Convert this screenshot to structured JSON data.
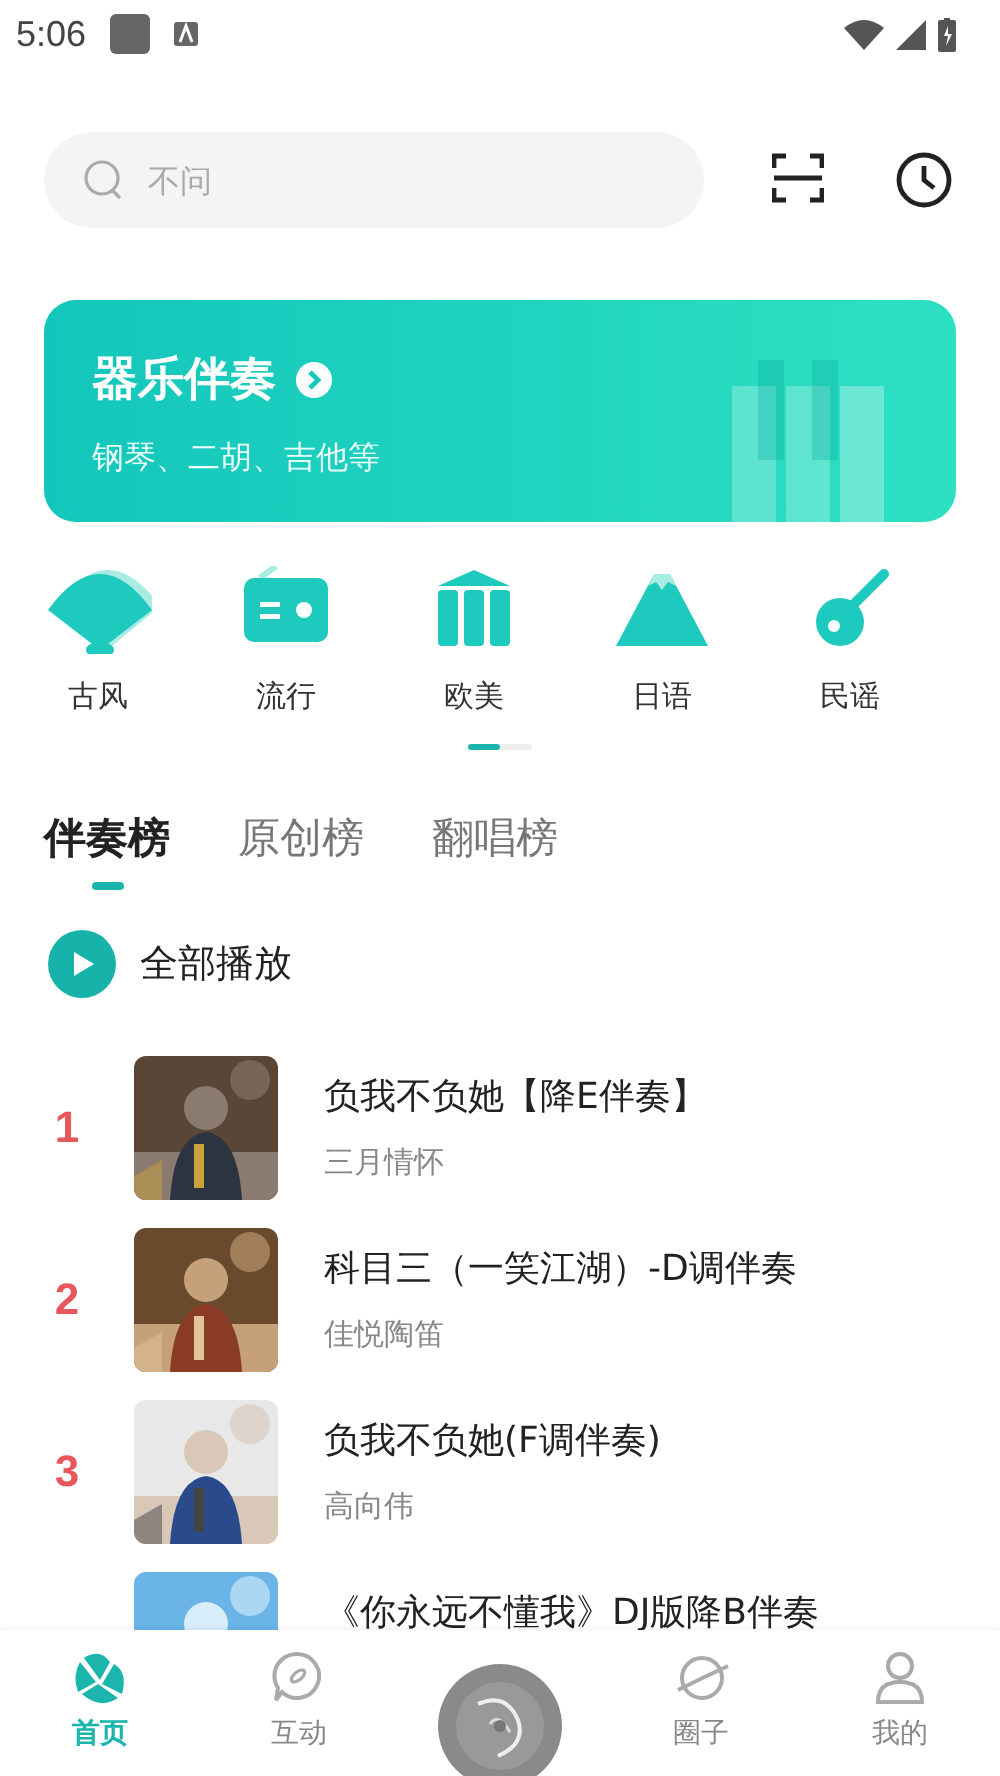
{
  "status_bar": {
    "time": "5:06"
  },
  "search": {
    "placeholder": "不问"
  },
  "banner": {
    "title": "器乐伴奏",
    "subtitle": "钢琴、二胡、吉他等"
  },
  "categories": [
    {
      "kind": "fan",
      "label": "古风"
    },
    {
      "kind": "radio",
      "label": "流行"
    },
    {
      "kind": "columns",
      "label": "欧美"
    },
    {
      "kind": "mountain",
      "label": "日语"
    },
    {
      "kind": "guitar",
      "label": "民谣"
    }
  ],
  "category_pager": {
    "level": 0.5
  },
  "tabs": [
    {
      "label": "伴奏榜",
      "selected": true
    },
    {
      "label": "原创榜",
      "selected": false
    },
    {
      "label": "翻唱榜",
      "selected": false
    }
  ],
  "play_all": {
    "label": "全部播放"
  },
  "songs": [
    {
      "rank": "1",
      "title": "负我不负她【降E伴奏】",
      "artist": "三月情怀"
    },
    {
      "rank": "2",
      "title": "科目三（一笑江湖）-D调伴奏",
      "artist": "佳悦陶笛"
    },
    {
      "rank": "3",
      "title": "负我不负她(F调伴奏)",
      "artist": "高向伟"
    },
    {
      "title": "《你永远不懂我》DJ版降B伴奏"
    }
  ],
  "nav": [
    {
      "kind": "home",
      "label": "首页",
      "selected": true
    },
    {
      "kind": "chat",
      "label": "互动",
      "selected": false
    },
    {
      "kind": "disc"
    },
    {
      "kind": "planet",
      "label": "圈子",
      "selected": false
    },
    {
      "kind": "person",
      "label": "我的",
      "selected": false
    }
  ]
}
